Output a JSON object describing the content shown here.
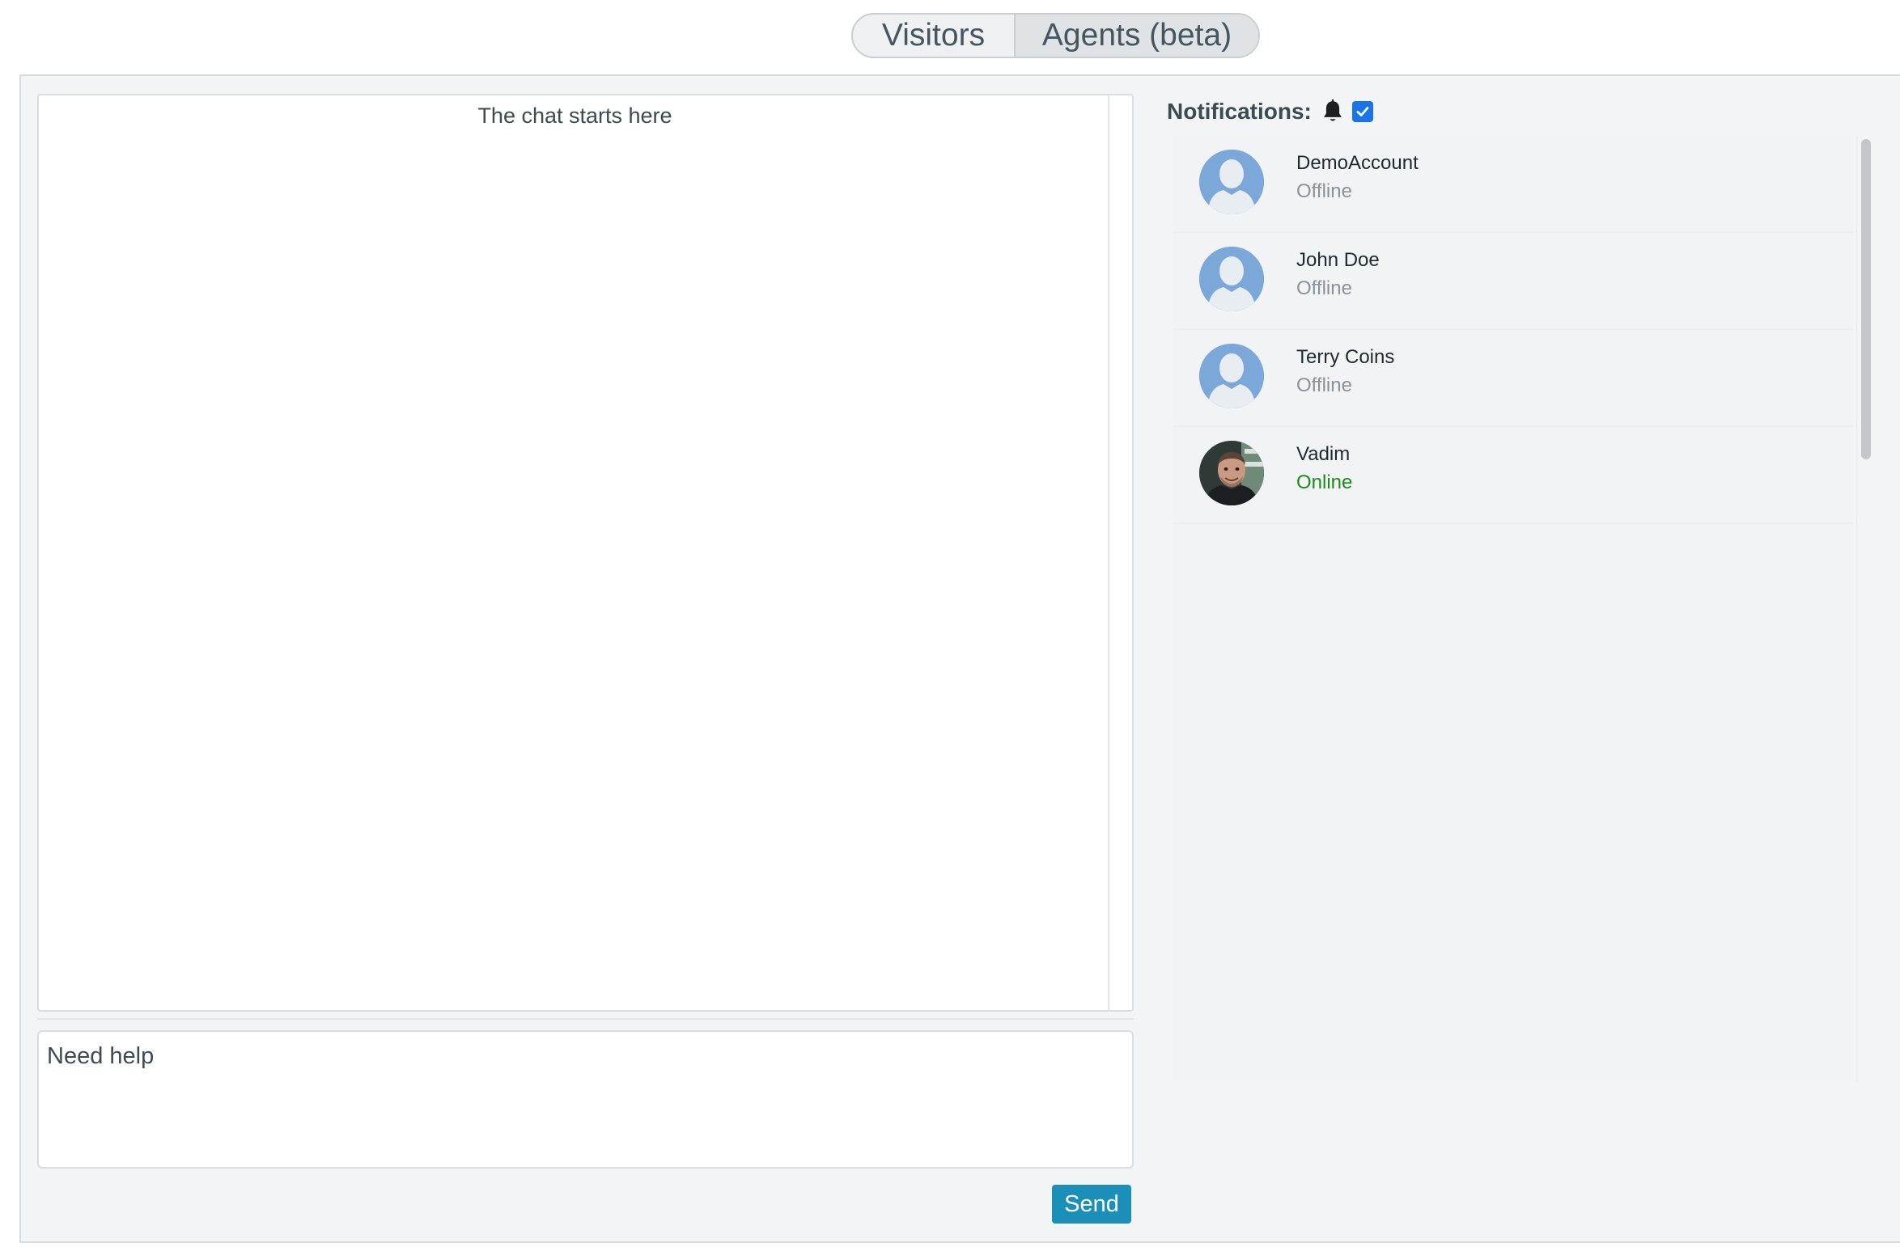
{
  "tabs": {
    "visitors": "Visitors",
    "agents": "Agents (beta)"
  },
  "chat": {
    "start_text": "The chat starts here",
    "input_value": "Need help",
    "send_label": "Send"
  },
  "notifications": {
    "label": "Notifications:",
    "enabled": true,
    "icon": "bell-icon"
  },
  "agents": [
    {
      "name": "DemoAccount",
      "status": "Offline",
      "avatar": "default-avatar"
    },
    {
      "name": "John Doe",
      "status": "Offline",
      "avatar": "default-avatar"
    },
    {
      "name": "Terry Coins",
      "status": "Offline",
      "avatar": "default-avatar"
    },
    {
      "name": "Vadim",
      "status": "Online",
      "avatar": "photo-avatar"
    }
  ],
  "colors": {
    "accent": "#1b8fb8",
    "online": "#1d8a1d",
    "offline": "#8a9298",
    "checkbox": "#1a73e8"
  }
}
